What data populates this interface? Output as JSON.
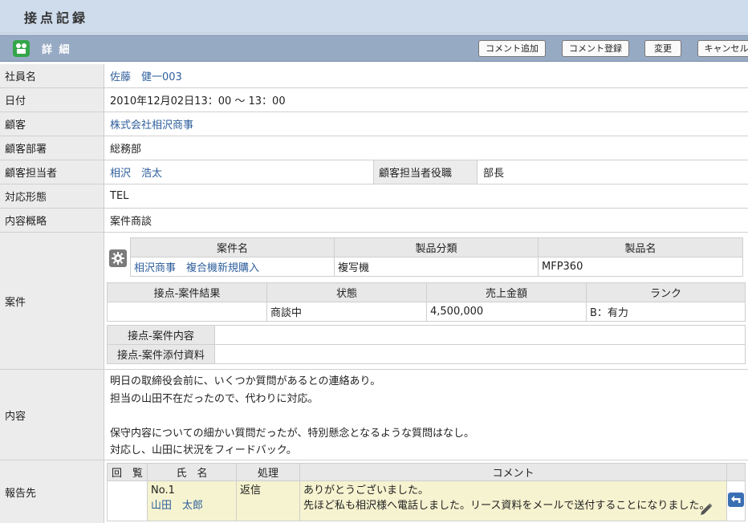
{
  "header": {
    "title": "接点記録"
  },
  "section": {
    "title": "詳 細"
  },
  "toolbar": {
    "add_comment": "コメント追加",
    "register_comment": "コメント登録",
    "change": "変更",
    "cancel": "キャンセル"
  },
  "fields": {
    "employee": {
      "label": "社員名",
      "value": "佐藤　健一003"
    },
    "date": {
      "label": "日付",
      "value": "2010年12月02日13：00 ～ 13：00"
    },
    "customer": {
      "label": "顧客",
      "value": "株式会社相沢商事"
    },
    "department": {
      "label": "顧客部署",
      "value": "総務部"
    },
    "contact": {
      "label": "顧客担当者",
      "value": "相沢　浩太"
    },
    "contact_title": {
      "label": "顧客担当者役職",
      "value": "部長"
    },
    "method": {
      "label": "対応形態",
      "value": "TEL"
    },
    "summary": {
      "label": "内容概略",
      "value": "案件商談"
    },
    "case": {
      "label": "案件"
    },
    "content": {
      "label": "内容"
    },
    "report": {
      "label": "報告先"
    }
  },
  "case_table": {
    "headers": [
      "案件名",
      "製品分類",
      "製品名"
    ],
    "row": [
      "相沢商事　複合機新規購入",
      "複写機",
      "MFP360"
    ]
  },
  "result_table": {
    "headers": [
      "接点-案件結果",
      "状態",
      "売上金額",
      "ランク"
    ],
    "row": [
      "",
      "商談中",
      "4,500,000",
      "B：有力"
    ]
  },
  "case_detail": {
    "content_label": "接点-案件内容",
    "content_value": "",
    "attach_label": "接点-案件添付資料",
    "attach_value": ""
  },
  "content_lines": [
    "明日の取締役会前に、いくつか質問があるとの連絡あり。",
    "担当の山田不在だったので、代わりに対応。",
    "",
    "保守内容についての細かい質問だったが、特別懸念となるような質問はなし。",
    "対応し、山田に状況をフィードバック。"
  ],
  "report_table": {
    "headers": [
      "回　覧",
      "氏　名",
      "処理",
      "コメント"
    ],
    "rows": [
      {
        "no": "No.1",
        "name": "山田　太郎",
        "action": "返信",
        "comment_line1": "ありがとうございました。",
        "comment_line2": "先ほど私も相沢様へ電話しました。リース資料をメールで送付することになりました。"
      }
    ]
  },
  "colors": {
    "link": "#2f5f9c",
    "section_bar": "#97aac4",
    "title_bar": "#cfdcec",
    "highlight": "#f6f3d0"
  },
  "icons": [
    "detail-icon",
    "gear-icon",
    "pencil-icon",
    "reply-icon"
  ]
}
